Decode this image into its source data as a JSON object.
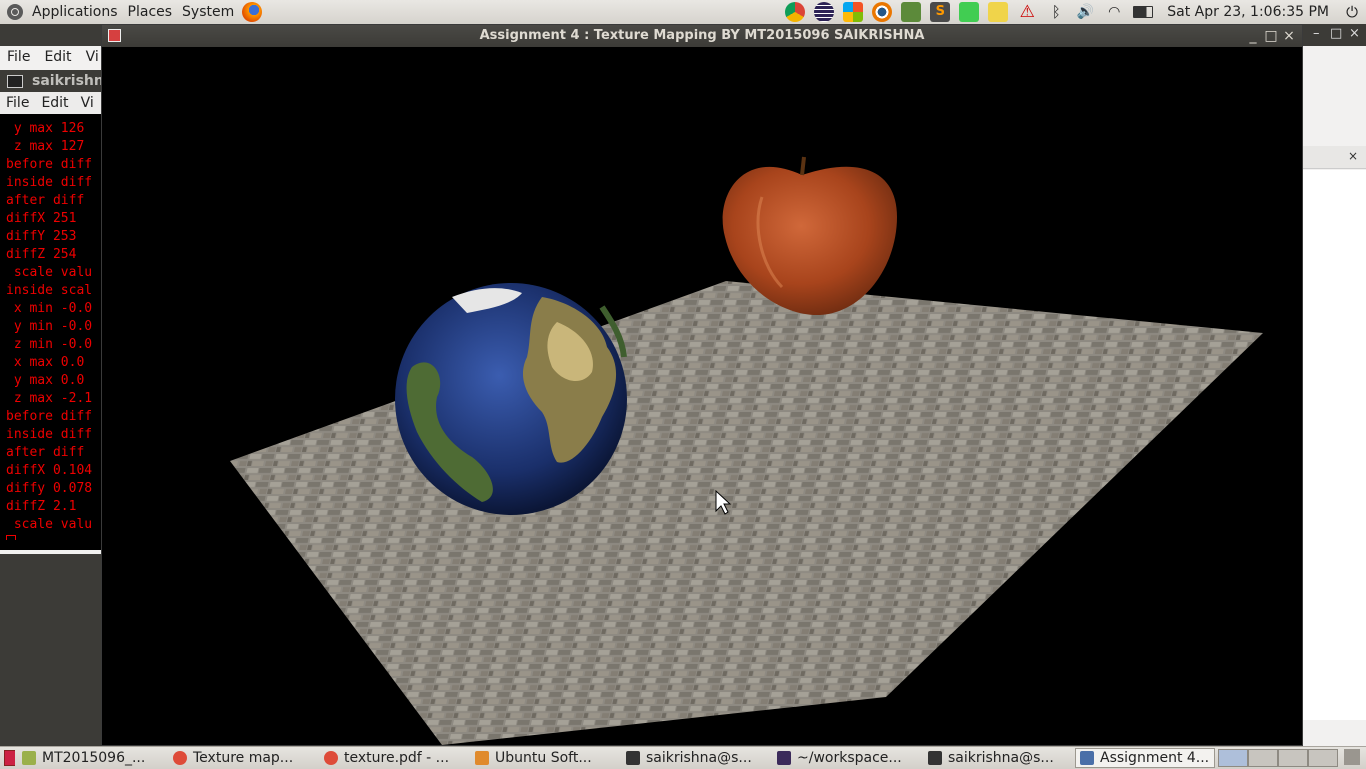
{
  "top_panel": {
    "menus": [
      "Applications",
      "Places",
      "System"
    ],
    "clock": "Sat Apr 23,  1:06:35 PM"
  },
  "file_manager": {
    "menus": [
      "File",
      "Edit",
      "Vi"
    ]
  },
  "terminal": {
    "title": "saikrishna",
    "menus": [
      "File",
      "Edit",
      "Vi"
    ],
    "lines": [
      " y max 126",
      " z max 127",
      "before diff",
      "inside diff",
      "after diff",
      "diffX 251",
      "diffY 253",
      "diffZ 254",
      " scale valu",
      "inside scal",
      " x min -0.0",
      " y min -0.0",
      " z min -0.0",
      " x max 0.0",
      " y max 0.0",
      " z max -2.1",
      "before diff",
      "inside diff",
      "after diff",
      "diffX 0.104",
      "diffy 0.078",
      "diffZ 2.1",
      " scale valu"
    ]
  },
  "main_window": {
    "title": "Assignment 4 : Texture Mapping BY MT2015096 SAIKRISHNA",
    "buttons": {
      "minimize": "_",
      "maximize": "□",
      "close": "×"
    }
  },
  "taskbar": {
    "tasks": [
      {
        "label": "MT2015096_...",
        "icon": "folder-icon",
        "color": "#9ab04a"
      },
      {
        "label": "Texture map...",
        "icon": "chrome-icon",
        "color": "#de4b39"
      },
      {
        "label": "texture.pdf - ...",
        "icon": "chrome-icon",
        "color": "#de4b39"
      },
      {
        "label": "Ubuntu Soft...",
        "icon": "software-center-icon",
        "color": "#e08a2c"
      },
      {
        "label": "saikrishna@s...",
        "icon": "terminal-icon",
        "color": "#333333"
      },
      {
        "label": "~/workspace...",
        "icon": "eclipse-icon",
        "color": "#3b2a5a"
      },
      {
        "label": "saikrishna@s...",
        "icon": "terminal-icon",
        "color": "#333333"
      },
      {
        "label": "Assignment 4...",
        "icon": "window-icon",
        "color": "#4a6fa8",
        "active": true
      }
    ]
  },
  "colors": {
    "panel": "#dcd9d3",
    "titlebar": "#3c3b37",
    "terminal_text": "#ee0000",
    "canvas_bg": "#000000",
    "floor": "#8f8a80",
    "apple": "#b14a1e",
    "ocean": "#1e3a78"
  }
}
